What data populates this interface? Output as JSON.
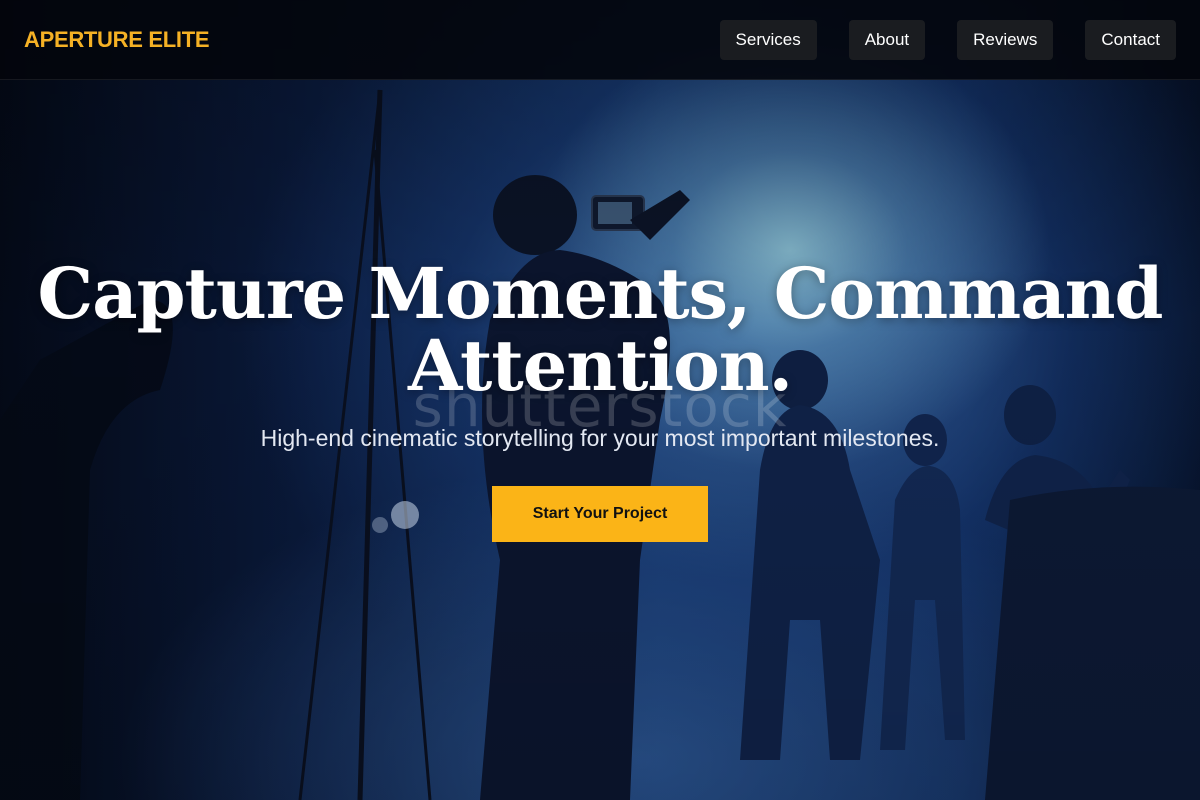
{
  "brand": {
    "name": "APERTURE ELITE",
    "color": "#f5b125"
  },
  "nav": {
    "items": [
      {
        "label": "Services"
      },
      {
        "label": "About"
      },
      {
        "label": "Reviews"
      },
      {
        "label": "Contact"
      }
    ]
  },
  "hero": {
    "title_line1": "Capture Moments, Command",
    "title_line2": "Attention.",
    "subtitle": "High-end cinematic storytelling for your most important milestones.",
    "cta_label": "Start Your Project",
    "cta_color": "#fbb417",
    "background": "videographer-at-event-photo",
    "watermark": "shutterstock"
  }
}
